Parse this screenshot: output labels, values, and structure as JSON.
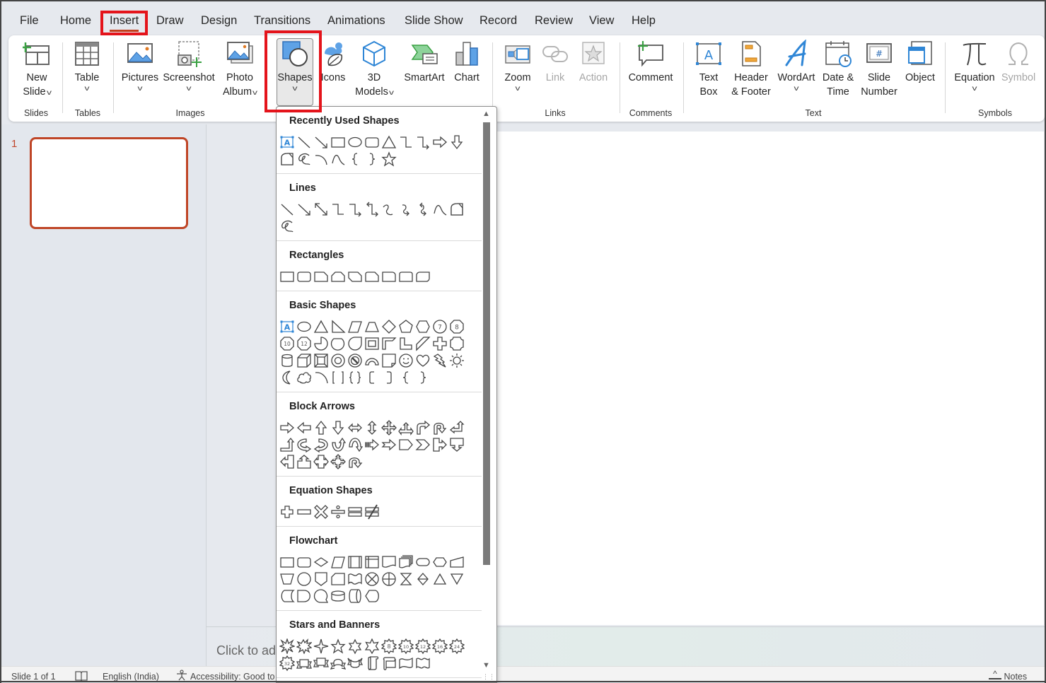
{
  "menu": {
    "tabs": [
      "File",
      "Home",
      "Insert",
      "Draw",
      "Design",
      "Transitions",
      "Animations",
      "Slide Show",
      "Record",
      "Review",
      "View",
      "Help"
    ],
    "active_tab": "Insert"
  },
  "ribbon": {
    "groups": {
      "slides": "Slides",
      "tables": "Tables",
      "images": "Images",
      "links": "Links",
      "comments": "Comments",
      "text": "Text",
      "symbols": "Symbols"
    },
    "buttons": {
      "new_slide": [
        "New",
        "Slide"
      ],
      "table": "Table",
      "pictures": "Pictures",
      "screenshot": "Screenshot",
      "photo_album": [
        "Photo",
        "Album"
      ],
      "shapes": "Shapes",
      "icons": "Icons",
      "models_3d": [
        "3D",
        "Models"
      ],
      "smartart": "SmartArt",
      "chart": "Chart",
      "zoom": "Zoom",
      "link": "Link",
      "action": "Action",
      "comment": "Comment",
      "text_box": [
        "Text",
        "Box"
      ],
      "header_footer": [
        "Header",
        "& Footer"
      ],
      "wordart": "WordArt",
      "date_time": [
        "Date &",
        "Time"
      ],
      "slide_number": [
        "Slide",
        "Number"
      ],
      "object": "Object",
      "equation": "Equation",
      "symbol": "Symbol"
    }
  },
  "thumbnails": {
    "slide_number": "1"
  },
  "notes": {
    "placeholder": "Click to add notes"
  },
  "status": {
    "slide_info": "Slide 1 of 1",
    "language": "English (India)",
    "accessibility": "Accessibility: Good to go",
    "notes_label": "Notes"
  },
  "shapes_menu": {
    "sections": [
      {
        "title": "Recently Used Shapes",
        "count": 19
      },
      {
        "title": "Lines",
        "count": 12
      },
      {
        "title": "Rectangles",
        "count": 9
      },
      {
        "title": "Basic Shapes",
        "count": 42
      },
      {
        "title": "Block Arrows",
        "count": 27
      },
      {
        "title": "Equation Shapes",
        "count": 6
      },
      {
        "title": "Flowchart",
        "count": 28
      },
      {
        "title": "Stars and Banners",
        "count": 20
      }
    ]
  },
  "colors": {
    "accent": "#c43e1c",
    "highlight_box": "#e4141b",
    "thumbnail_border": "#bf4526"
  }
}
